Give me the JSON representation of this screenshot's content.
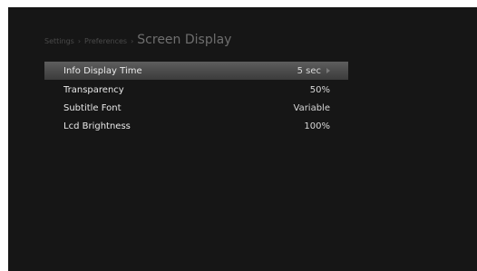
{
  "breadcrumb": {
    "level1": "Settings",
    "level2": "Preferences",
    "separator": "›",
    "title": "Screen Display"
  },
  "menu": {
    "items": [
      {
        "label": "Info Display Time",
        "value": "5 sec",
        "selected": true
      },
      {
        "label": "Transparency",
        "value": "50%",
        "selected": false
      },
      {
        "label": "Subtitle Font",
        "value": "Variable",
        "selected": false
      },
      {
        "label": "Lcd Brightness",
        "value": "100%",
        "selected": false
      }
    ]
  },
  "icons": {
    "selected_arrow": "chevron-right-icon"
  },
  "colors": {
    "background": "#161616",
    "highlight": "#4e4e4e",
    "text": "#e9e9e9"
  }
}
